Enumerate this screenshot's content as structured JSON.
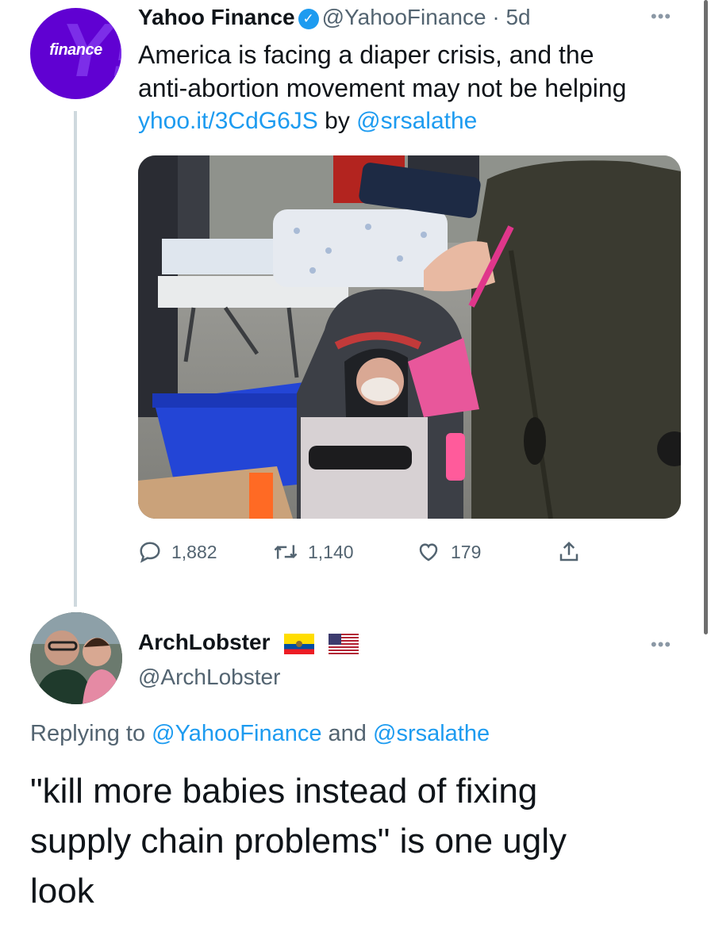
{
  "tweet": {
    "author_name": "Yahoo Finance",
    "handle": "@YahooFinance",
    "separator": "·",
    "age": "5d",
    "more_icon": "more-horizontal-icon",
    "avatar_text": "finance",
    "text_line_1": "America is facing a diaper crisis, and the",
    "text_line_2": "anti-abortion movement may not be helping",
    "link": "yhoo.it/3CdG6JS",
    "by": "by",
    "mention": "@srsalathe",
    "photo_description_icon": "photo",
    "stats": {
      "replies": "1,882",
      "retweets": "1,140",
      "likes": "179"
    }
  },
  "reply": {
    "author_name": "ArchLobster",
    "handle": "@ArchLobster",
    "flags": [
      "ecuador-flag-icon",
      "us-flag-icon"
    ],
    "replying_to_label": "Replying to",
    "replying_to_1": "@YahooFinance",
    "replying_and": "and",
    "replying_to_2": "@srsalathe",
    "text_line_1": "\"kill more babies instead of fixing",
    "text_line_2": "supply chain problems\" is one ugly",
    "text_line_3": "look"
  },
  "colors": {
    "link": "#1d9bf0",
    "muted": "#536471",
    "brand": "#6001d2",
    "text": "#0f1419"
  }
}
